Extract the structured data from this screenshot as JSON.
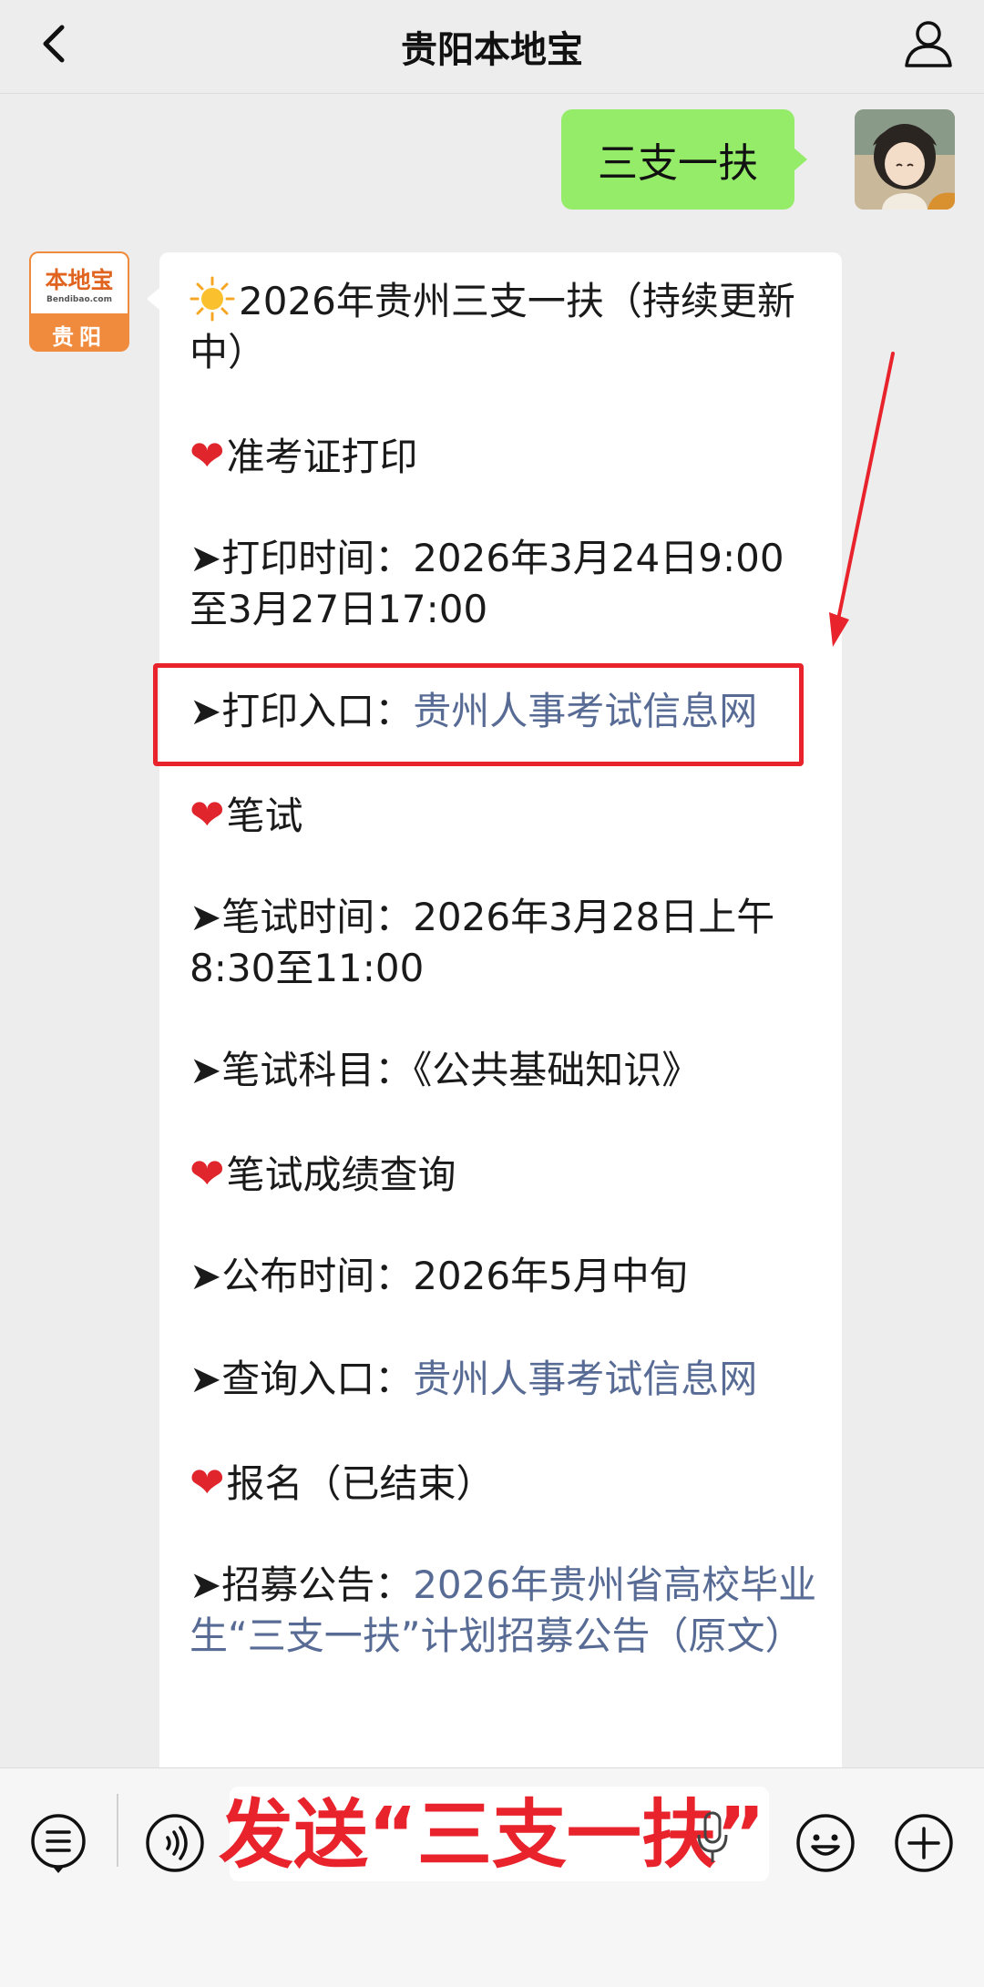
{
  "header": {
    "title": "贵阳本地宝"
  },
  "outgoing": {
    "text": "三支一扶"
  },
  "bot_avatar": {
    "brand": "本地宝",
    "url": "Bendibao.com",
    "city": "贵阳"
  },
  "message": {
    "title": "2026年贵州三支一扶（持续更新中）",
    "admission_heading": "准考证打印",
    "print_time": "➤打印时间：2026年3月24日9:00至3月27日17:00",
    "print_entry_label": "➤打印入口：",
    "print_entry_link": "贵州人事考试信息网",
    "exam_heading": "笔试",
    "exam_time": "➤笔试时间：2026年3月28日上午8:30至11:00",
    "exam_subject": "➤笔试科目：《公共基础知识》",
    "score_heading": "笔试成绩查询",
    "publish_time": "➤公布时间：2026年5月中旬",
    "query_entry_label": "➤查询入口：",
    "query_entry_link": "贵州人事考试信息网",
    "signup_heading": "报名（已结束）",
    "notice_label": "➤招募公告：",
    "notice_link": "2026年贵州省高校毕业生“三支一扶”计划招募公告（原文）"
  },
  "input_bar": {
    "overlay_text": "发送“三支一扶”"
  },
  "colors": {
    "link": "#576b95",
    "highlight": "#e8232c",
    "outgoing_bubble": "#95ec69"
  },
  "icons": [
    "back-arrow-icon",
    "profile-icon",
    "sun-icon",
    "heart-icon",
    "menu-list-icon",
    "voice-icon",
    "microphone-icon",
    "emoji-icon",
    "plus-icon"
  ]
}
